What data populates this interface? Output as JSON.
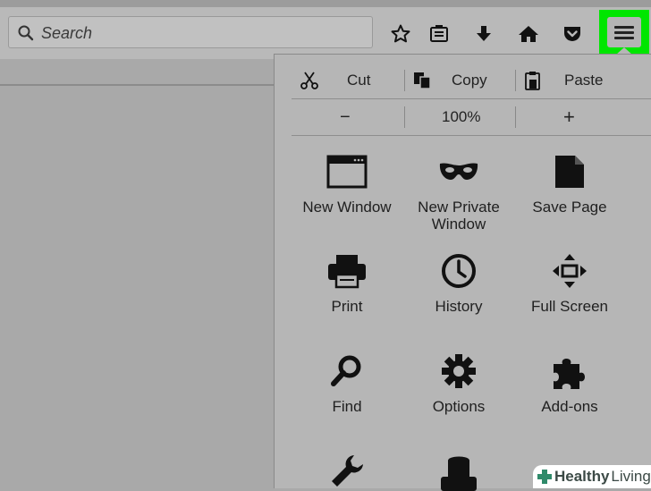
{
  "toolbar": {
    "search_placeholder": "Search",
    "icons": [
      "bookmark-star-icon",
      "reading-list-icon",
      "download-icon",
      "home-icon",
      "pocket-icon",
      "hamburger-menu-icon"
    ],
    "highlight_color": "#00e600"
  },
  "menu": {
    "edit": {
      "cut": "Cut",
      "copy": "Copy",
      "paste": "Paste"
    },
    "zoom": {
      "minus": "−",
      "level": "100%",
      "plus": "+"
    },
    "tiles": [
      {
        "label": "New Window",
        "icon": "new-window-icon"
      },
      {
        "label": "New Private Window",
        "icon": "private-mask-icon"
      },
      {
        "label": "Save Page",
        "icon": "save-page-icon"
      },
      {
        "label": "Print",
        "icon": "printer-icon"
      },
      {
        "label": "History",
        "icon": "history-clock-icon"
      },
      {
        "label": "Full Screen",
        "icon": "full-screen-icon"
      },
      {
        "label": "Find",
        "icon": "magnifier-icon"
      },
      {
        "label": "Options",
        "icon": "gear-icon"
      },
      {
        "label": "Add-ons",
        "icon": "puzzle-piece-icon"
      },
      {
        "label": "",
        "icon": "wrench-icon"
      },
      {
        "label": "",
        "icon": "hat-icon"
      }
    ]
  },
  "watermark": {
    "bold": "Healthy",
    "rest": "Living"
  }
}
